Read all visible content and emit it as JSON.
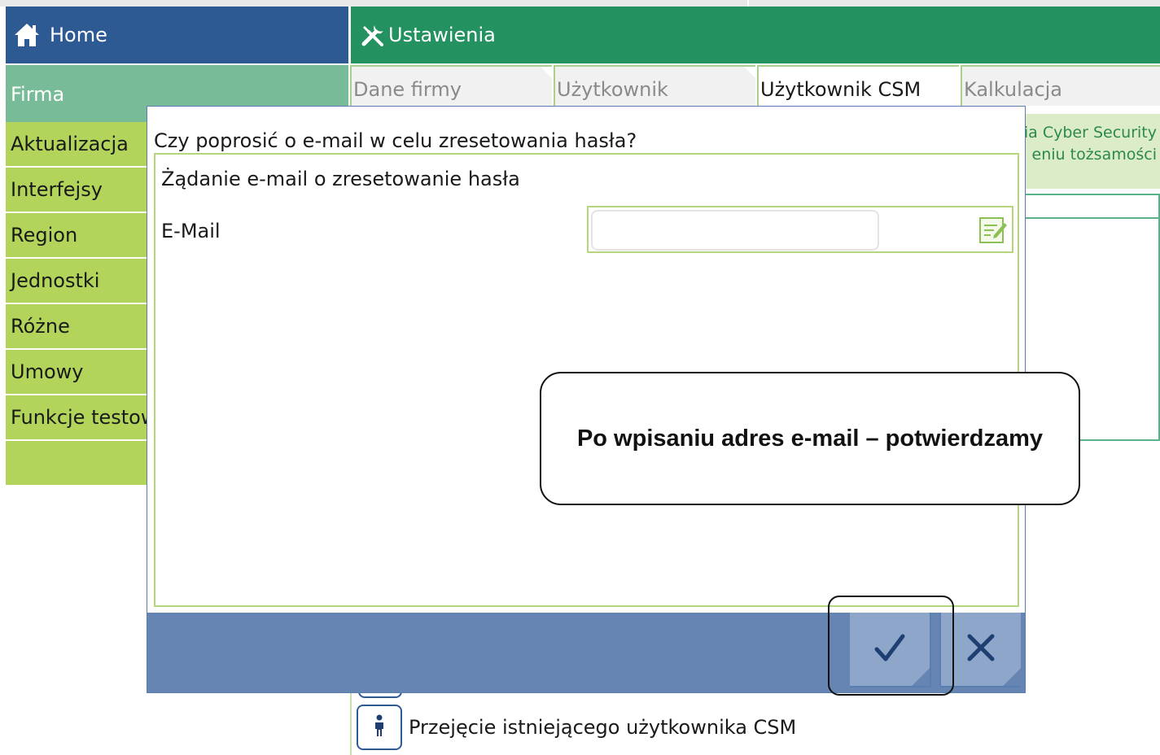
{
  "header": {
    "home_label": "Home",
    "home_icon": "home-icon",
    "settings_label": "Ustawienia",
    "settings_icon": "tools-icon",
    "colors": {
      "home_bar": "#2e5a94",
      "settings_bar": "#239160"
    }
  },
  "sidebar": {
    "section": "Firma",
    "items": [
      {
        "label": "Aktualizacja"
      },
      {
        "label": "Interfejsy"
      },
      {
        "label": "Region"
      },
      {
        "label": "Jednostki"
      },
      {
        "label": "Różne"
      },
      {
        "label": "Umowy"
      },
      {
        "label": "Funkcje testowe"
      }
    ]
  },
  "tabs": [
    {
      "label": "Dane firmy",
      "active": false
    },
    {
      "label": "Użytkownik",
      "active": false
    },
    {
      "label": "Użytkownik CSM",
      "active": true
    },
    {
      "label": "Kalkulacja",
      "active": false
    }
  ],
  "background_panel": {
    "cyber_line1": "ia Cyber Security",
    "cyber_line2": "eniu tożsamości",
    "takeover_label": "Przejęcie istniejącego użytkownika CSM",
    "takeover_icon": "person-icon"
  },
  "dialog": {
    "title": "Czy poprosić o e-mail w celu zresetowania hasła?",
    "heading": "Żądanie e-mail o zresetowanie hasła",
    "email_label": "E-Mail",
    "email_value": "",
    "email_placeholder": "",
    "edit_icon": "edit-note-icon",
    "confirm_icon": "checkmark-icon",
    "cancel_icon": "close-icon"
  },
  "annotation": {
    "callout_text": "Po wpisaniu adres e-mail – potwierdzamy"
  }
}
